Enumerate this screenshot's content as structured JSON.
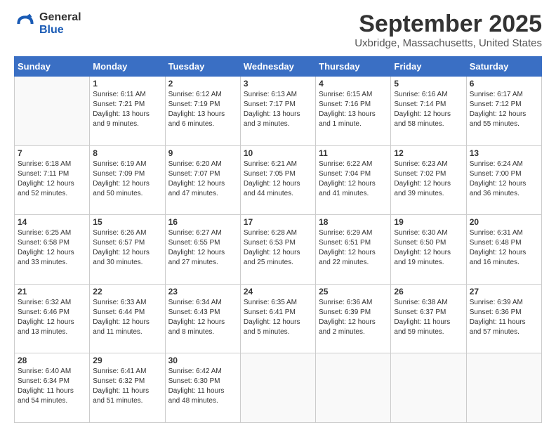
{
  "logo": {
    "general": "General",
    "blue": "Blue"
  },
  "title": "September 2025",
  "location": "Uxbridge, Massachusetts, United States",
  "days_of_week": [
    "Sunday",
    "Monday",
    "Tuesday",
    "Wednesday",
    "Thursday",
    "Friday",
    "Saturday"
  ],
  "weeks": [
    [
      {
        "day": "",
        "info": ""
      },
      {
        "day": "1",
        "info": "Sunrise: 6:11 AM\nSunset: 7:21 PM\nDaylight: 13 hours\nand 9 minutes."
      },
      {
        "day": "2",
        "info": "Sunrise: 6:12 AM\nSunset: 7:19 PM\nDaylight: 13 hours\nand 6 minutes."
      },
      {
        "day": "3",
        "info": "Sunrise: 6:13 AM\nSunset: 7:17 PM\nDaylight: 13 hours\nand 3 minutes."
      },
      {
        "day": "4",
        "info": "Sunrise: 6:15 AM\nSunset: 7:16 PM\nDaylight: 13 hours\nand 1 minute."
      },
      {
        "day": "5",
        "info": "Sunrise: 6:16 AM\nSunset: 7:14 PM\nDaylight: 12 hours\nand 58 minutes."
      },
      {
        "day": "6",
        "info": "Sunrise: 6:17 AM\nSunset: 7:12 PM\nDaylight: 12 hours\nand 55 minutes."
      }
    ],
    [
      {
        "day": "7",
        "info": "Sunrise: 6:18 AM\nSunset: 7:11 PM\nDaylight: 12 hours\nand 52 minutes."
      },
      {
        "day": "8",
        "info": "Sunrise: 6:19 AM\nSunset: 7:09 PM\nDaylight: 12 hours\nand 50 minutes."
      },
      {
        "day": "9",
        "info": "Sunrise: 6:20 AM\nSunset: 7:07 PM\nDaylight: 12 hours\nand 47 minutes."
      },
      {
        "day": "10",
        "info": "Sunrise: 6:21 AM\nSunset: 7:05 PM\nDaylight: 12 hours\nand 44 minutes."
      },
      {
        "day": "11",
        "info": "Sunrise: 6:22 AM\nSunset: 7:04 PM\nDaylight: 12 hours\nand 41 minutes."
      },
      {
        "day": "12",
        "info": "Sunrise: 6:23 AM\nSunset: 7:02 PM\nDaylight: 12 hours\nand 39 minutes."
      },
      {
        "day": "13",
        "info": "Sunrise: 6:24 AM\nSunset: 7:00 PM\nDaylight: 12 hours\nand 36 minutes."
      }
    ],
    [
      {
        "day": "14",
        "info": "Sunrise: 6:25 AM\nSunset: 6:58 PM\nDaylight: 12 hours\nand 33 minutes."
      },
      {
        "day": "15",
        "info": "Sunrise: 6:26 AM\nSunset: 6:57 PM\nDaylight: 12 hours\nand 30 minutes."
      },
      {
        "day": "16",
        "info": "Sunrise: 6:27 AM\nSunset: 6:55 PM\nDaylight: 12 hours\nand 27 minutes."
      },
      {
        "day": "17",
        "info": "Sunrise: 6:28 AM\nSunset: 6:53 PM\nDaylight: 12 hours\nand 25 minutes."
      },
      {
        "day": "18",
        "info": "Sunrise: 6:29 AM\nSunset: 6:51 PM\nDaylight: 12 hours\nand 22 minutes."
      },
      {
        "day": "19",
        "info": "Sunrise: 6:30 AM\nSunset: 6:50 PM\nDaylight: 12 hours\nand 19 minutes."
      },
      {
        "day": "20",
        "info": "Sunrise: 6:31 AM\nSunset: 6:48 PM\nDaylight: 12 hours\nand 16 minutes."
      }
    ],
    [
      {
        "day": "21",
        "info": "Sunrise: 6:32 AM\nSunset: 6:46 PM\nDaylight: 12 hours\nand 13 minutes."
      },
      {
        "day": "22",
        "info": "Sunrise: 6:33 AM\nSunset: 6:44 PM\nDaylight: 12 hours\nand 11 minutes."
      },
      {
        "day": "23",
        "info": "Sunrise: 6:34 AM\nSunset: 6:43 PM\nDaylight: 12 hours\nand 8 minutes."
      },
      {
        "day": "24",
        "info": "Sunrise: 6:35 AM\nSunset: 6:41 PM\nDaylight: 12 hours\nand 5 minutes."
      },
      {
        "day": "25",
        "info": "Sunrise: 6:36 AM\nSunset: 6:39 PM\nDaylight: 12 hours\nand 2 minutes."
      },
      {
        "day": "26",
        "info": "Sunrise: 6:38 AM\nSunset: 6:37 PM\nDaylight: 11 hours\nand 59 minutes."
      },
      {
        "day": "27",
        "info": "Sunrise: 6:39 AM\nSunset: 6:36 PM\nDaylight: 11 hours\nand 57 minutes."
      }
    ],
    [
      {
        "day": "28",
        "info": "Sunrise: 6:40 AM\nSunset: 6:34 PM\nDaylight: 11 hours\nand 54 minutes."
      },
      {
        "day": "29",
        "info": "Sunrise: 6:41 AM\nSunset: 6:32 PM\nDaylight: 11 hours\nand 51 minutes."
      },
      {
        "day": "30",
        "info": "Sunrise: 6:42 AM\nSunset: 6:30 PM\nDaylight: 11 hours\nand 48 minutes."
      },
      {
        "day": "",
        "info": ""
      },
      {
        "day": "",
        "info": ""
      },
      {
        "day": "",
        "info": ""
      },
      {
        "day": "",
        "info": ""
      }
    ]
  ]
}
